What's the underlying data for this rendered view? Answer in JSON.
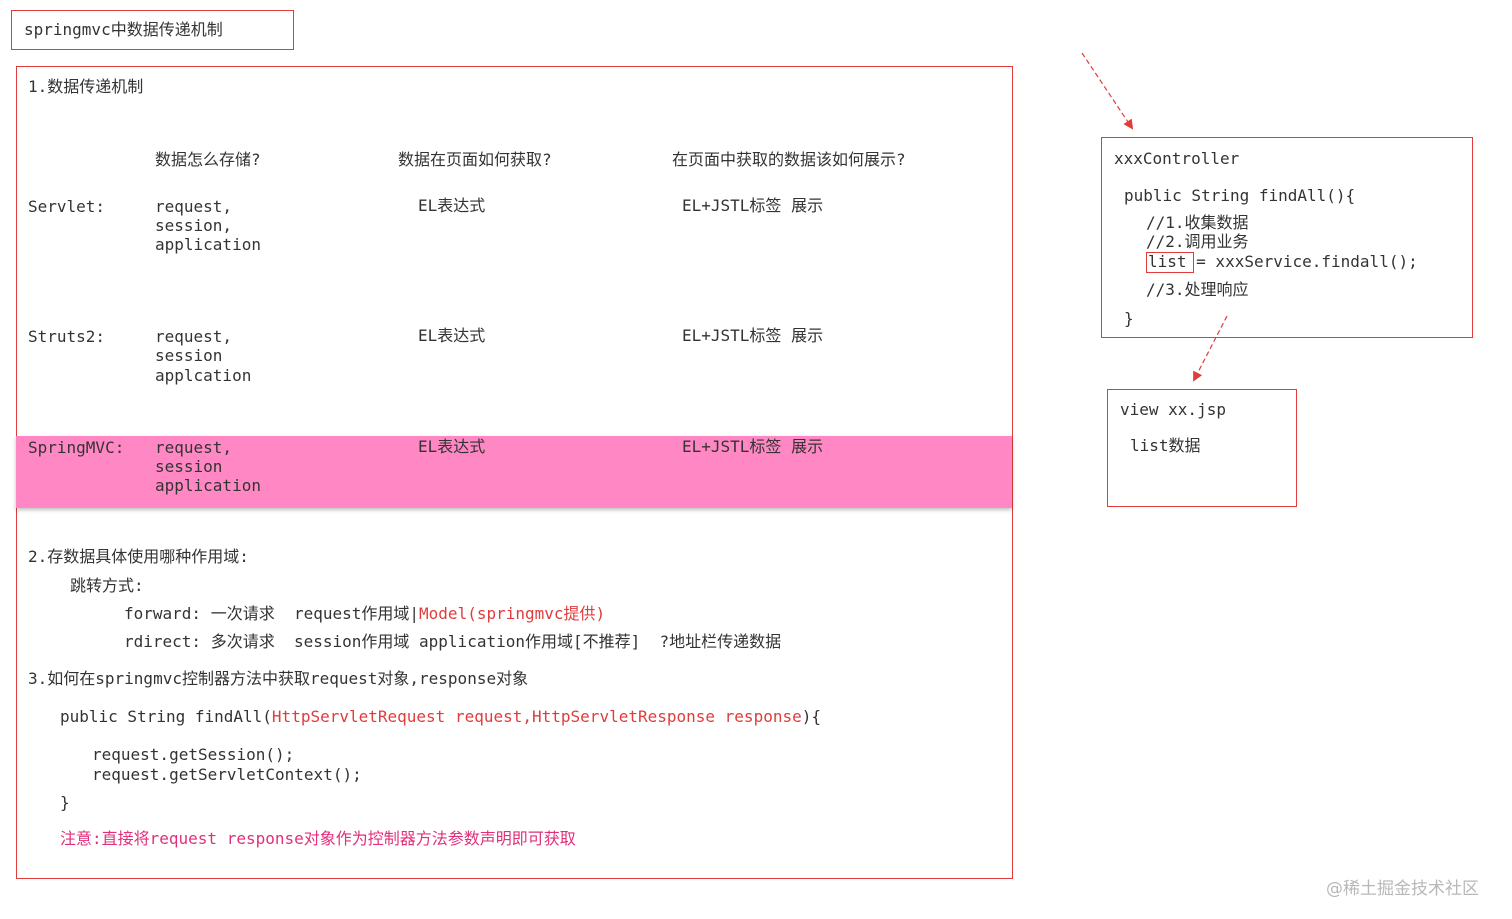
{
  "title": "springmvc中数据传递机制",
  "section1": {
    "heading": "1.数据传递机制",
    "col_headers": [
      "数据怎么存储?",
      "数据在页面如何获取?",
      "在页面中获取的数据该如何展示?"
    ],
    "rows": [
      {
        "name": "Servlet:",
        "storage": [
          "request,",
          "session,",
          "application"
        ],
        "fetch": "EL表达式",
        "display": "EL+JSTL标签 展示"
      },
      {
        "name": "Struts2:",
        "storage": [
          "request,",
          "session",
          "applcation"
        ],
        "fetch": "EL表达式",
        "display": "EL+JSTL标签 展示"
      },
      {
        "name": "SpringMVC:",
        "storage": [
          "request,",
          "session",
          "application"
        ],
        "fetch": "EL表达式",
        "display": "EL+JSTL标签 展示"
      }
    ]
  },
  "section2": {
    "heading": "2.存数据具体使用哪种作用域:",
    "sub": "跳转方式:",
    "forward_prefix": "forward: 一次请求  request作用域|",
    "forward_red": "Model(springmvc提供)",
    "redirect": "rdirect: 多次请求  session作用域 application作用域[不推荐]  ?地址栏传递数据"
  },
  "section3": {
    "heading": "3.如何在springmvc控制器方法中获取request对象,response对象",
    "sig_prefix": "public String findAll(",
    "sig_red": "HttpServletRequest request,HttpServletResponse response",
    "sig_suffix": "){",
    "line1": "request.getSession();",
    "line2": "request.getServletContext();",
    "close": "}",
    "note": "注意:直接将request response对象作为控制器方法参数声明即可获取"
  },
  "controller": {
    "title": "xxxController",
    "sig": "public String findAll(){",
    "c1": "//1.收集数据",
    "c2": "//2.调用业务",
    "list_word": "list",
    "assign": " = xxxService.findall();",
    "c3": "//3.处理响应",
    "close": "}"
  },
  "view": {
    "title": "view xx.jsp",
    "content": "list数据"
  },
  "watermark": "@稀土掘金技术社区",
  "colors": {
    "border": "#e03c3c",
    "highlight": "#ff88c4",
    "note": "#e0307a"
  }
}
